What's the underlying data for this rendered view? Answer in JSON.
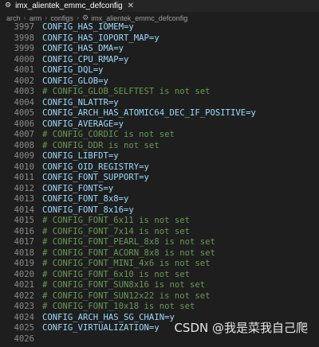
{
  "tab": {
    "title": "imx_alientek_emmc_defconfig",
    "icon": "gear-icon",
    "close": "✕"
  },
  "breadcrumb": {
    "items": [
      "arch",
      "arm",
      "configs"
    ],
    "file": "imx_alientek_emmc_defconfig"
  },
  "editor": {
    "lines": [
      {
        "num": "3997",
        "text": "CONFIG_HAS_IOMEM=y",
        "comment": false
      },
      {
        "num": "3998",
        "text": "CONFIG_HAS_IOPORT_MAP=y",
        "comment": false
      },
      {
        "num": "3999",
        "text": "CONFIG_HAS_DMA=y",
        "comment": false
      },
      {
        "num": "4000",
        "text": "CONFIG_CPU_RMAP=y",
        "comment": false
      },
      {
        "num": "4001",
        "text": "CONFIG_DQL=y",
        "comment": false
      },
      {
        "num": "4002",
        "text": "CONFIG_GLOB=y",
        "comment": false
      },
      {
        "num": "4003",
        "text": "# CONFIG_GLOB_SELFTEST is not set",
        "comment": true
      },
      {
        "num": "4004",
        "text": "CONFIG_NLATTR=y",
        "comment": false
      },
      {
        "num": "4005",
        "text": "CONFIG_ARCH_HAS_ATOMIC64_DEC_IF_POSITIVE=y",
        "comment": false
      },
      {
        "num": "4006",
        "text": "CONFIG_AVERAGE=y",
        "comment": false
      },
      {
        "num": "4007",
        "text": "# CONFIG_CORDIC is not set",
        "comment": true
      },
      {
        "num": "4008",
        "text": "# CONFIG_DDR is not set",
        "comment": true
      },
      {
        "num": "4009",
        "text": "CONFIG_LIBFDT=y",
        "comment": false
      },
      {
        "num": "4010",
        "text": "CONFIG_OID_REGISTRY=y",
        "comment": false
      },
      {
        "num": "4011",
        "text": "CONFIG_FONT_SUPPORT=y",
        "comment": false
      },
      {
        "num": "4012",
        "text": "CONFIG_FONTS=y",
        "comment": false
      },
      {
        "num": "4013",
        "text": "CONFIG_FONT_8x8=y",
        "comment": false
      },
      {
        "num": "4014",
        "text": "CONFIG_FONT_8x16=y",
        "comment": false
      },
      {
        "num": "4015",
        "text": "# CONFIG_FONT_6x11 is not set",
        "comment": true
      },
      {
        "num": "4016",
        "text": "# CONFIG_FONT_7x14 is not set",
        "comment": true
      },
      {
        "num": "4017",
        "text": "# CONFIG_FONT_PEARL_8x8 is not set",
        "comment": true
      },
      {
        "num": "4018",
        "text": "# CONFIG_FONT_ACORN_8x8 is not set",
        "comment": true
      },
      {
        "num": "4019",
        "text": "# CONFIG_FONT_MINI_4x6 is not set",
        "comment": true
      },
      {
        "num": "4020",
        "text": "# CONFIG_FONT_6x10 is not set",
        "comment": true
      },
      {
        "num": "4021",
        "text": "# CONFIG_FONT_SUN8x16 is not set",
        "comment": true
      },
      {
        "num": "4022",
        "text": "# CONFIG_FONT_SUN12x22 is not set",
        "comment": true
      },
      {
        "num": "4023",
        "text": "# CONFIG_FONT_10x18 is not set",
        "comment": true
      },
      {
        "num": "4024",
        "text": "CONFIG_ARCH_HAS_SG_CHAIN=y",
        "comment": false
      },
      {
        "num": "4025",
        "text": "CONFIG_VIRTUALIZATION=y",
        "comment": false
      },
      {
        "num": "4026",
        "text": "",
        "comment": false
      }
    ]
  },
  "watermark": "CSDN @我是菜我自己爬",
  "colors": {
    "background": "#1e1e1e",
    "code": "#9cdcfe",
    "comment": "#6a9955",
    "line_number": "#8a8a8a"
  }
}
